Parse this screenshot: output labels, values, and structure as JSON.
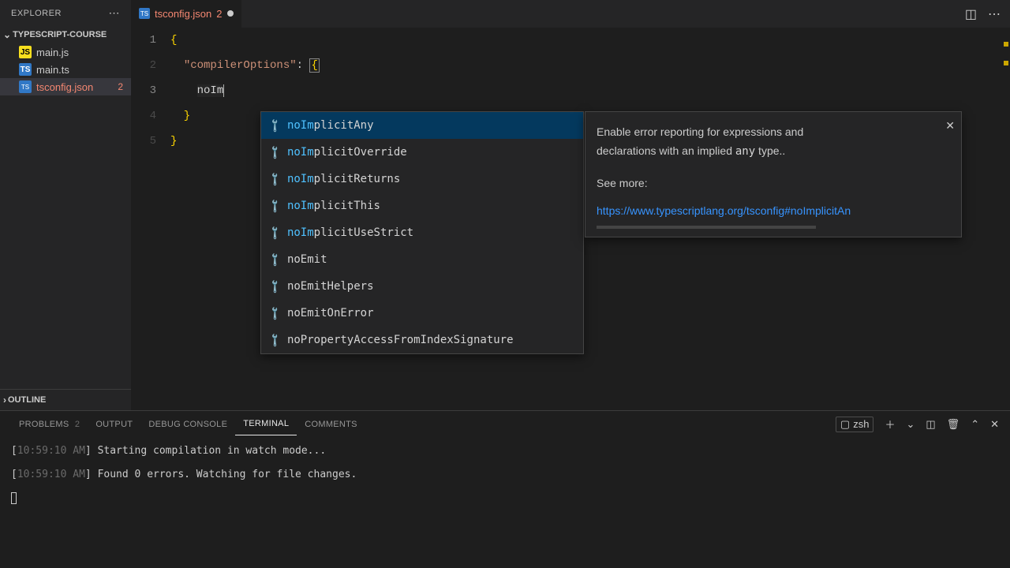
{
  "sidebar": {
    "title": "EXPLORER",
    "folder": "TYPESCRIPT-COURSE",
    "files": [
      {
        "name": "main.js",
        "icon": "JS",
        "problems": null
      },
      {
        "name": "main.ts",
        "icon": "TS",
        "problems": null
      },
      {
        "name": "tsconfig.json",
        "icon": "TS",
        "problems": 2
      }
    ],
    "outline": "OUTLINE"
  },
  "tabs": {
    "open": {
      "label": "tsconfig.json",
      "problems": "2"
    }
  },
  "code": {
    "lines": [
      "1",
      "2",
      "3",
      "4",
      "5"
    ],
    "l1": "{",
    "l2_key": "\"compilerOptions\"",
    "l2_colon": ": ",
    "l2_brace": "{",
    "l3_indent": "    ",
    "l3_text": "noIm",
    "l4": "  }",
    "l5": "}"
  },
  "autocomplete": {
    "prefix": "noIm",
    "items": [
      "noImplicitAny",
      "noImplicitOverride",
      "noImplicitReturns",
      "noImplicitThis",
      "noImplicitUseStrict",
      "noEmit",
      "noEmitHelpers",
      "noEmitOnError",
      "noPropertyAccessFromIndexSignature"
    ]
  },
  "doc": {
    "line1a": "Enable error reporting for expressions and",
    "line1b": "declarations with an implied ",
    "any": "any",
    "line1c": " type..",
    "see": "See more:",
    "link": "https://www.typescriptlang.org/tsconfig#noImplicitAn"
  },
  "panel": {
    "tabs": {
      "problems": "PROBLEMS",
      "problems_count": "2",
      "output": "OUTPUT",
      "debug": "DEBUG CONSOLE",
      "terminal": "TERMINAL",
      "comments": "COMMENTS"
    },
    "shell": "zsh",
    "term": {
      "time": "10:59:10 AM",
      "l1": "Starting compilation in watch mode...",
      "l2": "Found 0 errors. Watching for file changes."
    }
  }
}
